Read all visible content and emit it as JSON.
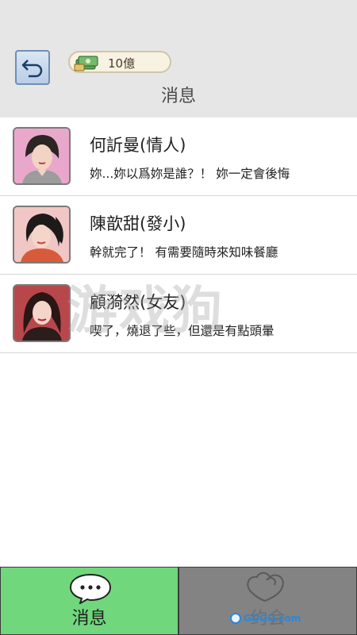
{
  "header": {
    "title": "消息",
    "money": "10億",
    "back_icon": "undo-arrow-icon",
    "money_icon": "cash-stack-icon"
  },
  "contacts": [
    {
      "name": "何訢曼(情人)",
      "preview": "妳...妳以爲妳是誰？！ 妳一定會後悔",
      "avatar_bg": "#e7a4c6"
    },
    {
      "name": "陳歆甜(發小)",
      "preview": "幹就完了！ 有需要隨時來知味餐廳",
      "avatar_bg": "#f2c2bd"
    },
    {
      "name": "顧漪然(女友)",
      "preview": "喫了，燒退了些，但還是有點頭暈",
      "avatar_bg": "#b04347"
    }
  ],
  "tabs": {
    "messages": {
      "label": "消息",
      "icon": "chat-bubble-icon"
    },
    "dating": {
      "label": "约会",
      "icon": "heart-balloon-icon"
    }
  },
  "watermark": "游戏狗",
  "logo_text": "GOGO.com",
  "colors": {
    "active_tab": "#70d77d",
    "inactive_tab": "#838383",
    "header_bg": "#e6e6e6"
  }
}
